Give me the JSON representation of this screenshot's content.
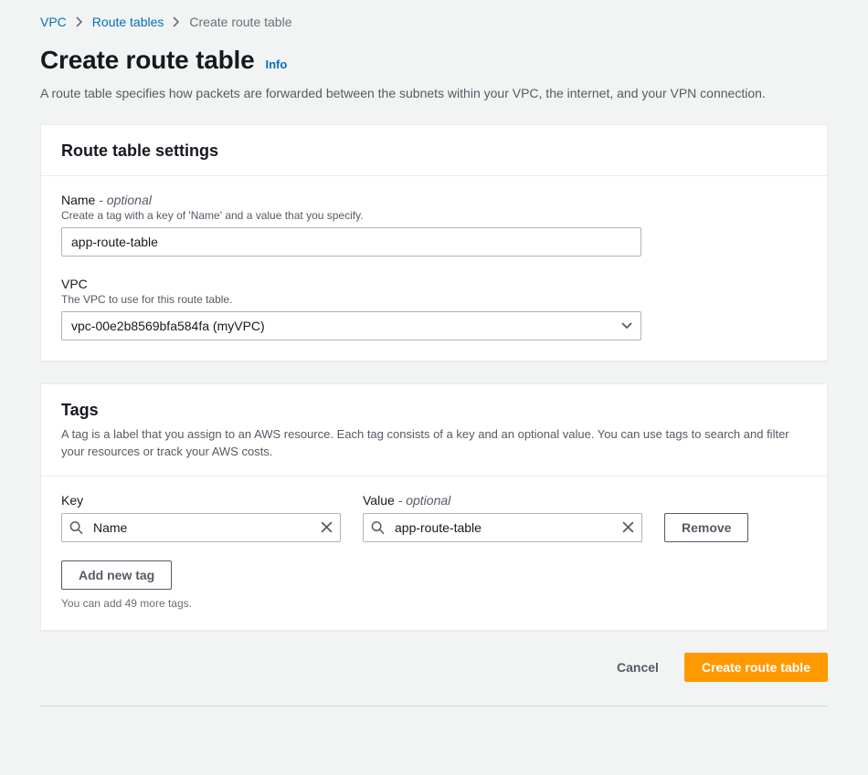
{
  "breadcrumbs": {
    "items": [
      "VPC",
      "Route tables",
      "Create route table"
    ]
  },
  "header": {
    "title": "Create route table",
    "info": "Info",
    "description": "A route table specifies how packets are forwarded between the subnets within your VPC, the internet, and your VPN connection."
  },
  "settings_panel": {
    "title": "Route table settings",
    "name": {
      "label": "Name",
      "optional": " - optional",
      "help": "Create a tag with a key of 'Name' and a value that you specify.",
      "value": "app-route-table"
    },
    "vpc": {
      "label": "VPC",
      "help": "The VPC to use for this route table.",
      "selected": "vpc-00e2b8569bfa584fa (myVPC)"
    }
  },
  "tags_panel": {
    "title": "Tags",
    "description": "A tag is a label that you assign to an AWS resource. Each tag consists of a key and an optional value. You can use tags to search and filter your resources or track your AWS costs.",
    "key_label": "Key",
    "value_label": "Value",
    "value_optional": " - optional",
    "rows": [
      {
        "key": "Name",
        "value": "app-route-table"
      }
    ],
    "remove_label": "Remove",
    "add_label": "Add new tag",
    "add_hint": "You can add 49 more tags."
  },
  "actions": {
    "cancel": "Cancel",
    "submit": "Create route table"
  }
}
